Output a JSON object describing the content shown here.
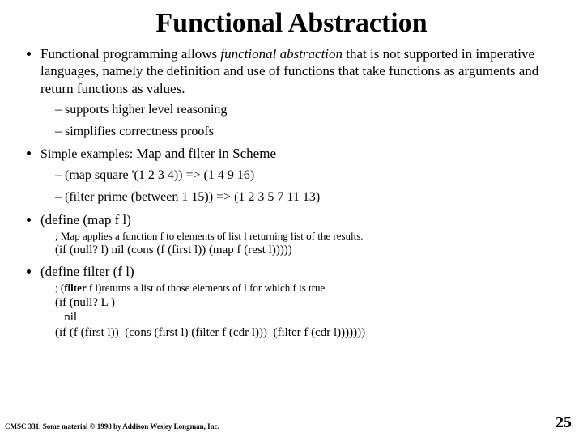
{
  "title": "Functional Abstraction",
  "bullet1": {
    "pre": "Functional programming allows ",
    "em": "functional abstraction",
    "post": " that is not supported in imperative languages, namely the definition and use of functions that take functions as arguments and return functions as values.",
    "sub1": "supports higher level reasoning",
    "sub2": "simplifies correctness proofs"
  },
  "bullet2": {
    "prefix": "Simple examples: ",
    "main": "Map and filter in Scheme",
    "sub1": "(map square '(1 2 3 4)) => (1 4 9 16)",
    "sub2": "(filter prime (between 1 15)) => (1 2 3 5 7 11 13)"
  },
  "bullet3": {
    "head": "(define (map f l)",
    "c1": "; Map applies a function f to elements of list l returning list of the results.",
    "c2": "(if (null? l) nil (cons (f (first l)) (map f (rest l)))))"
  },
  "bullet4": {
    "head": "(define filter (f l)",
    "c1_pre": "; (",
    "c1_bold": "filter",
    "c1_post": " f l)returns a list of those elements of l for which f is true",
    "c2": "(if (null? L )",
    "c3": "   nil",
    "c4": "(if (f (first l))  (cons (first l) (filter f (cdr l)))  (filter f (cdr l)))))))"
  },
  "footer": "CMSC 331. Some material © 1998 by Addison Wesley Longman, Inc.",
  "page": "25"
}
